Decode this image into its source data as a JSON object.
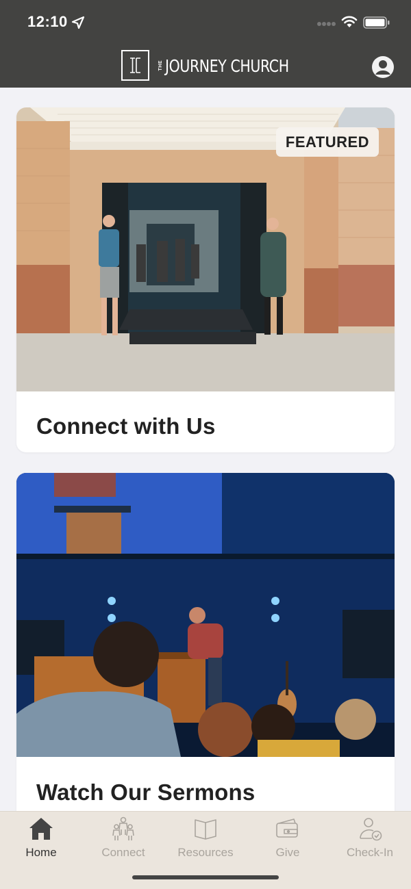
{
  "status_bar": {
    "time": "12:10",
    "icons": [
      "location-arrow-icon",
      "signal-icon",
      "wifi-icon",
      "battery-icon"
    ]
  },
  "header": {
    "logo_small": "THE",
    "logo_name": "JOURNEY CHURCH",
    "icons": [
      "logo-mark-icon",
      "profile-icon"
    ]
  },
  "cards": [
    {
      "title": "Connect with Us",
      "badge": "FEATURED"
    },
    {
      "title": "Watch Our Sermons"
    }
  ],
  "tabs": [
    {
      "label": "Home",
      "icon": "home-icon",
      "active": true
    },
    {
      "label": "Connect",
      "icon": "people-icon",
      "active": false
    },
    {
      "label": "Resources",
      "icon": "book-icon",
      "active": false
    },
    {
      "label": "Give",
      "icon": "wallet-icon",
      "active": false
    },
    {
      "label": "Check-In",
      "icon": "check-in-icon",
      "active": false
    }
  ],
  "colors": {
    "header_bg": "#434341",
    "page_bg": "#f2f2f6",
    "tabbar_bg": "#ebe5dd",
    "tab_active": "#333333",
    "tab_inactive": "#a9a49d"
  }
}
